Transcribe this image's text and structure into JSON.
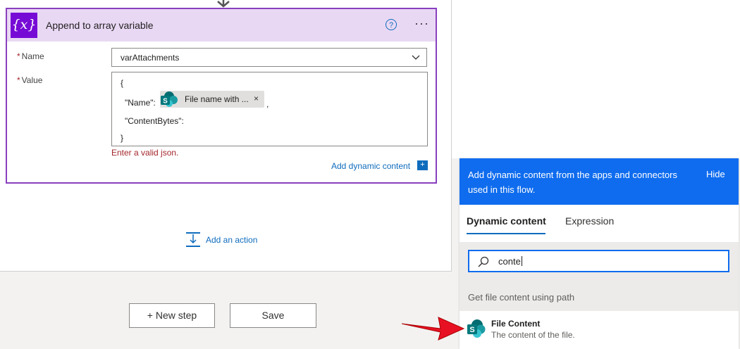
{
  "card": {
    "icon_text": "{x}",
    "title": "Append to array variable",
    "help_icon_text": "?",
    "more_icon_text": "···"
  },
  "fields": {
    "name_label": "Name",
    "required_mark": "*",
    "name_value": "varAttachments",
    "value_label": "Value",
    "value_lines": {
      "open": "{",
      "name_key": "\"Name\":",
      "token_label": "File name with ...",
      "token_close": "×",
      "comma": ",",
      "content_key": "\"ContentBytes\":",
      "close": "}"
    },
    "error": "Enter a valid json.",
    "add_dynamic": "Add dynamic content",
    "add_dynamic_icon": "+"
  },
  "canvas": {
    "add_action": "Add an action",
    "new_step": "+ New step",
    "save": "Save"
  },
  "panel": {
    "header_text": "Add dynamic content from the apps and connectors used in this flow.",
    "hide": "Hide",
    "tabs": [
      "Dynamic content",
      "Expression"
    ],
    "active_tab": "Dynamic content",
    "search_value": "conte",
    "group_label": "Get file content using path",
    "items": [
      {
        "title": "File Content",
        "description": "The content of the file.",
        "icon": "sharepoint-icon"
      }
    ]
  },
  "colors": {
    "accent": "#0f6cee",
    "card_border": "#8a3fbf",
    "card_header": "#e9d8f4",
    "variable_icon": "#770bd6",
    "error": "#a4262c",
    "arrow": "#e81123"
  }
}
